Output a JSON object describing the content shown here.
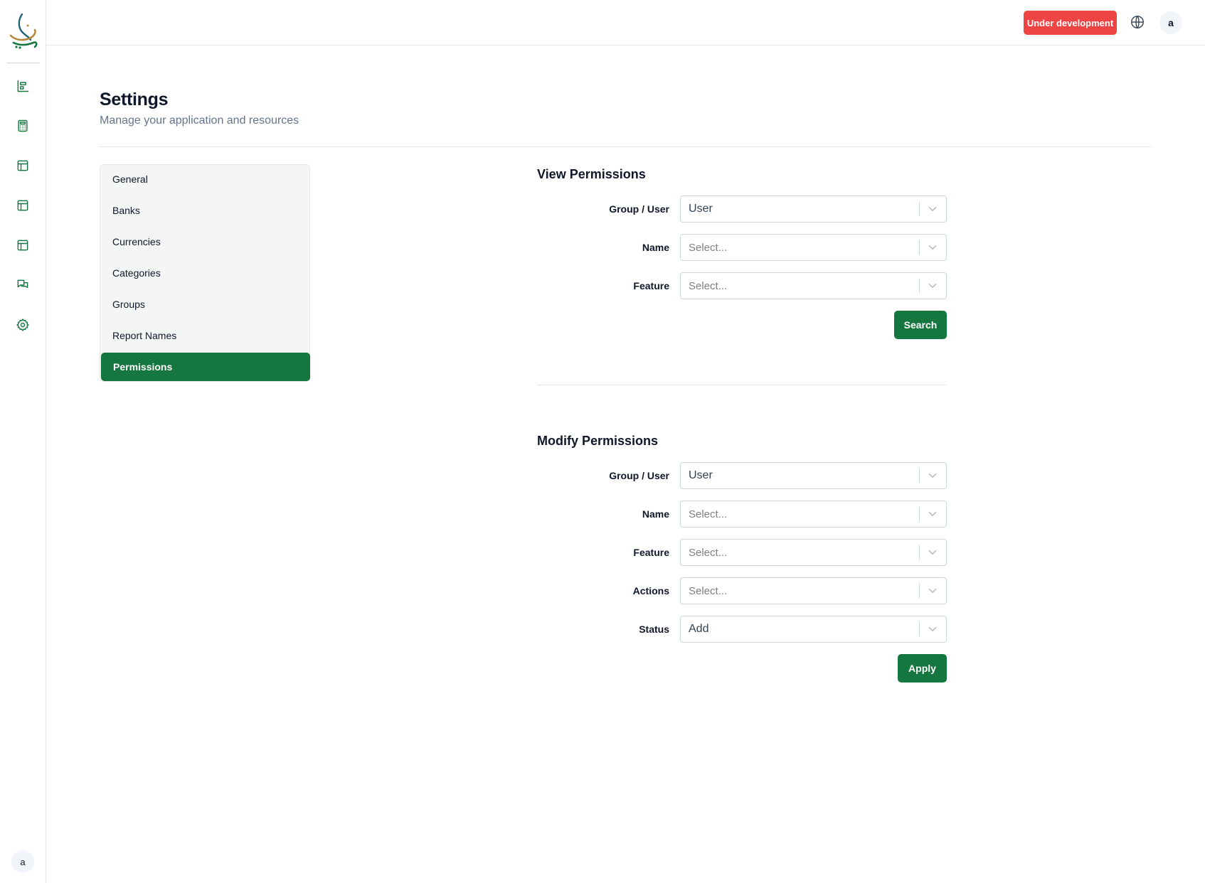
{
  "topbar": {
    "dev_badge": "Under development",
    "avatar_initial": "a"
  },
  "rail": {
    "icons": [
      "chart-icon",
      "calculator-icon",
      "table-icon",
      "table-icon",
      "table-icon",
      "chat-icon",
      "gear-icon"
    ],
    "avatar_initial": "a"
  },
  "header": {
    "title": "Settings",
    "subtitle": "Manage your application and resources"
  },
  "settings_nav": {
    "items": [
      {
        "label": "General"
      },
      {
        "label": "Banks"
      },
      {
        "label": "Currencies"
      },
      {
        "label": "Categories"
      },
      {
        "label": "Groups"
      },
      {
        "label": "Report Names"
      },
      {
        "label": "Permissions",
        "active": true
      }
    ]
  },
  "view_permissions": {
    "title": "View Permissions",
    "fields": [
      {
        "label": "Group / User",
        "value": "User",
        "placeholder": ""
      },
      {
        "label": "Name",
        "value": "",
        "placeholder": "Select..."
      },
      {
        "label": "Feature",
        "value": "",
        "placeholder": "Select..."
      }
    ],
    "button": "Search"
  },
  "modify_permissions": {
    "title": "Modify Permissions",
    "fields": [
      {
        "label": "Group / User",
        "value": "User",
        "placeholder": ""
      },
      {
        "label": "Name",
        "value": "",
        "placeholder": "Select..."
      },
      {
        "label": "Feature",
        "value": "",
        "placeholder": "Select..."
      },
      {
        "label": "Actions",
        "value": "",
        "placeholder": "Select..."
      },
      {
        "label": "Status",
        "value": "Add",
        "placeholder": ""
      }
    ],
    "button": "Apply"
  },
  "colors": {
    "brand_green": "#16763f",
    "dev_badge_red": "#ef4444"
  }
}
